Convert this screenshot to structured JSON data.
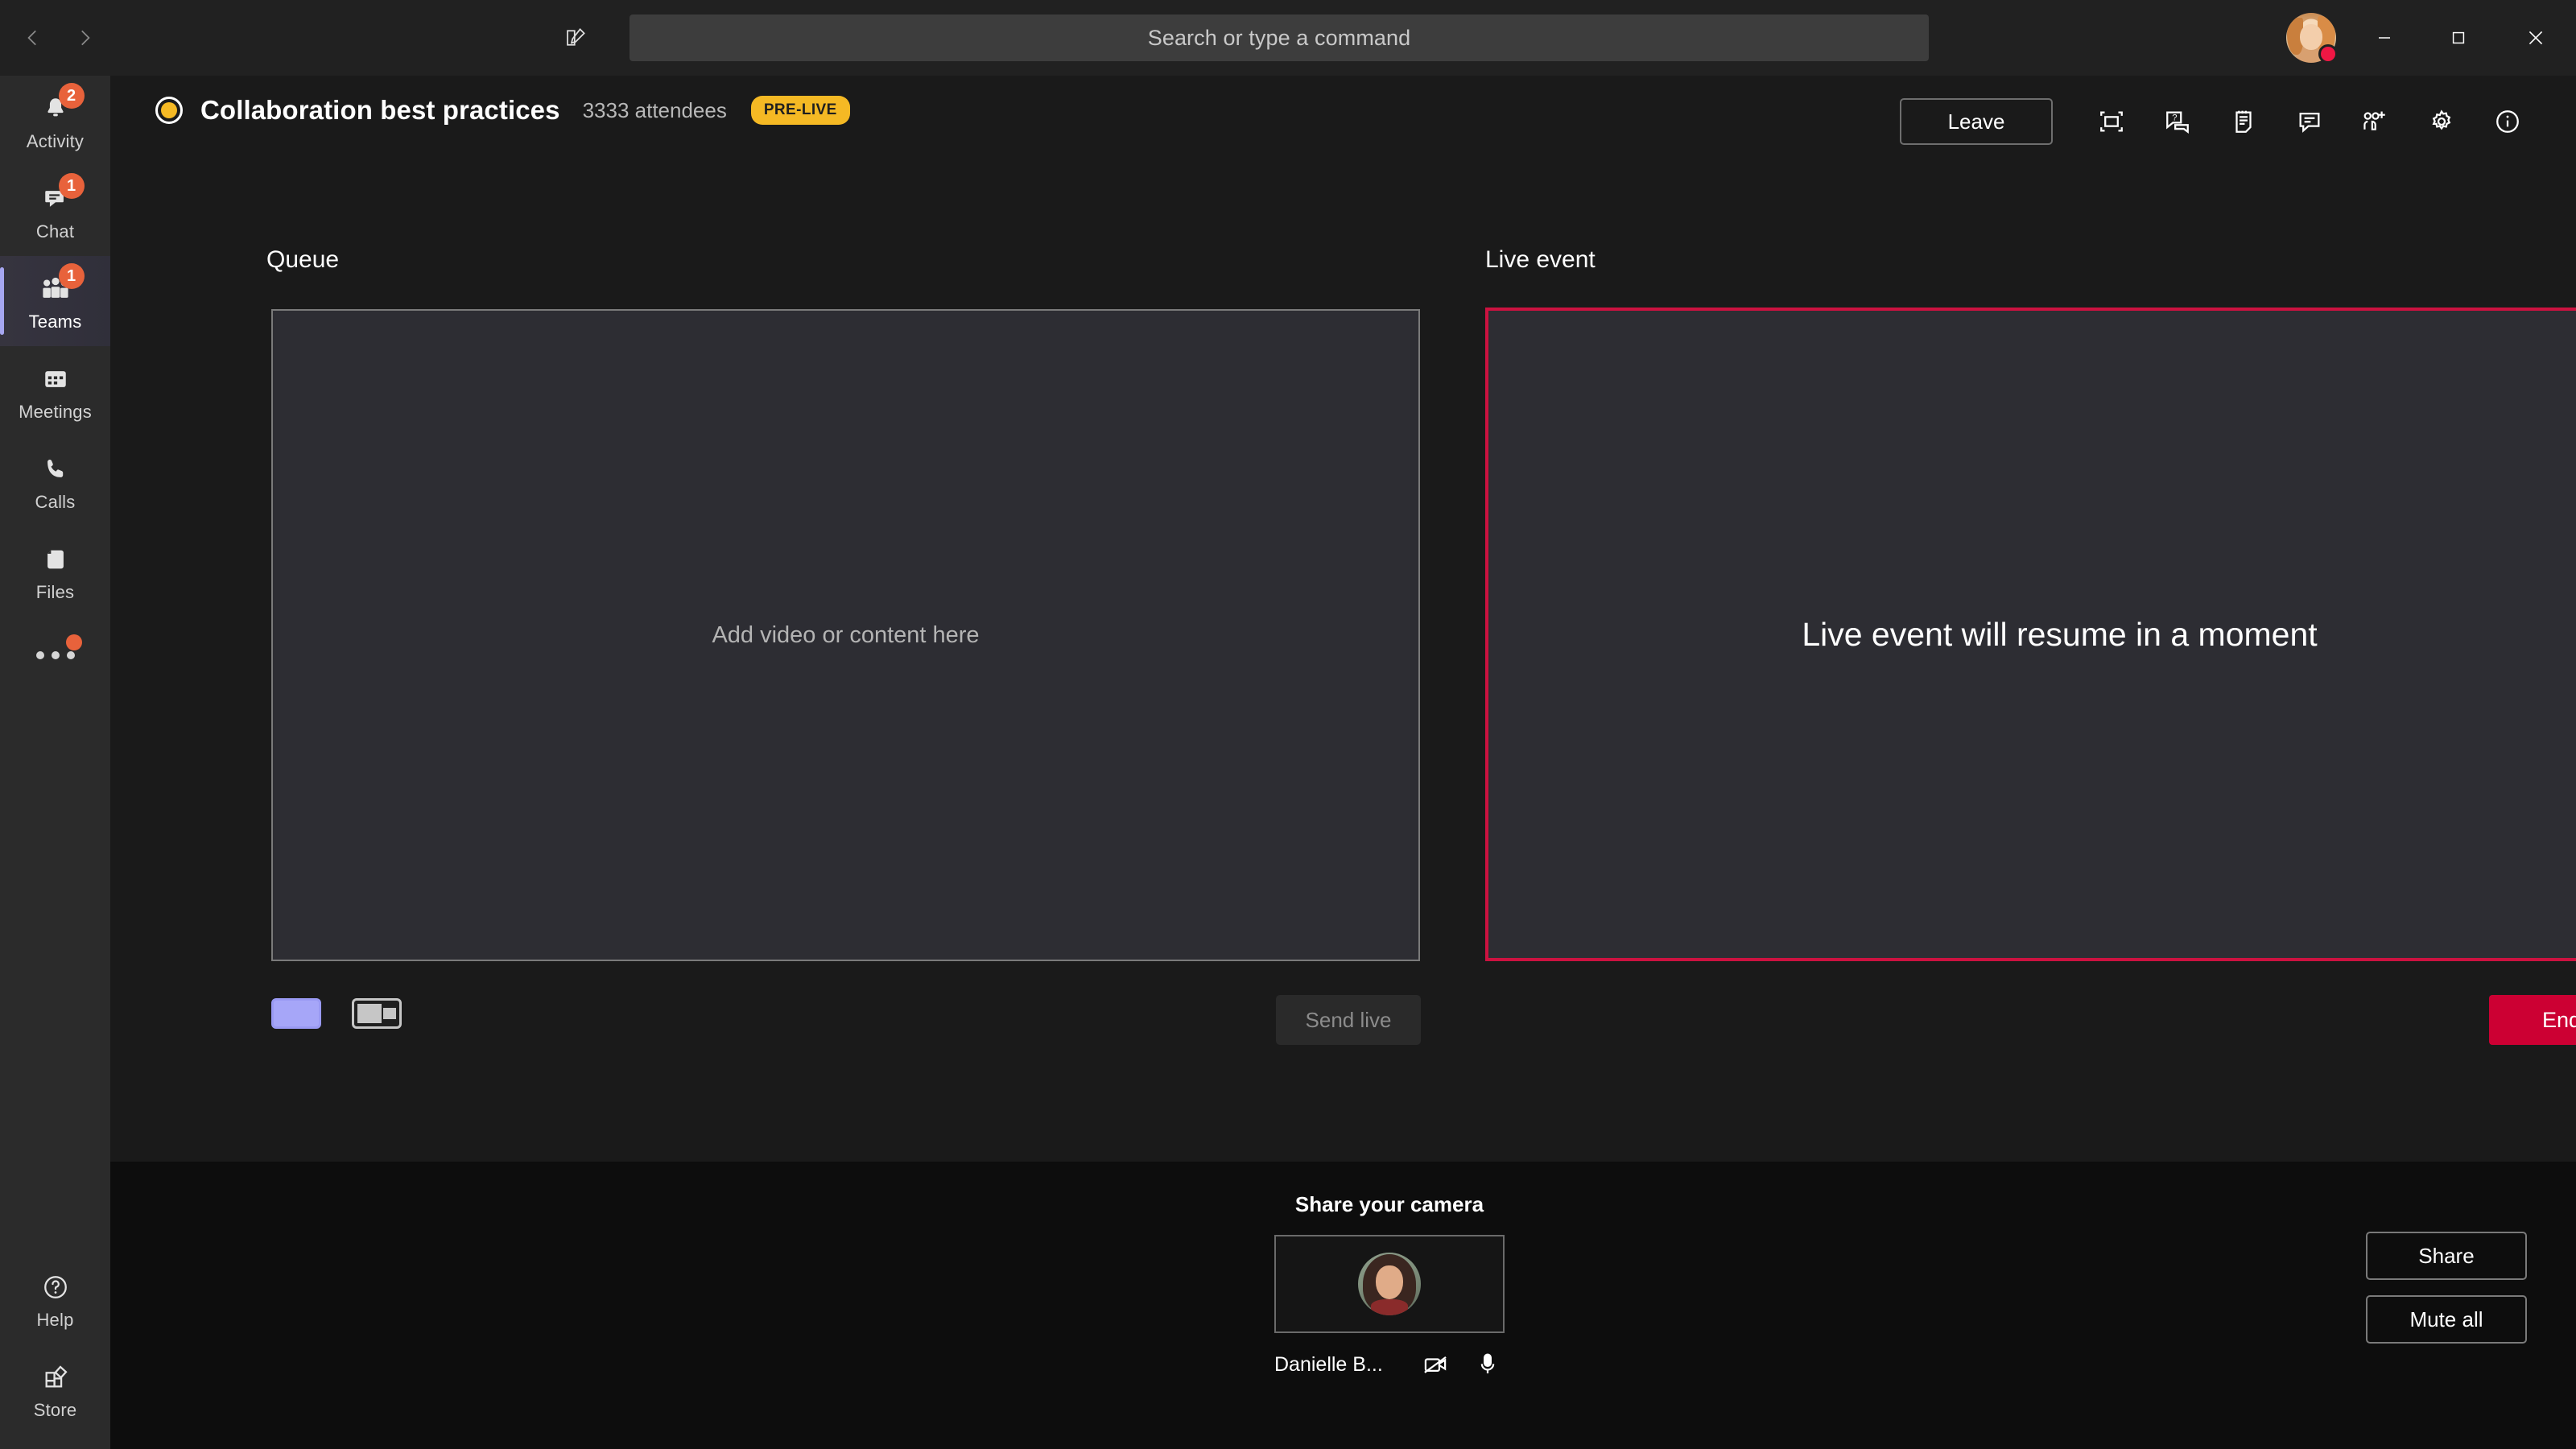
{
  "titlebar": {
    "back_icon": "chevron-left-icon",
    "forward_icon": "chevron-right-icon",
    "compose_icon": "compose-icon",
    "search": {
      "placeholder": "Search or type a command",
      "value": ""
    },
    "avatar_name": "user-avatar",
    "presence": "busy",
    "minimize_label": "Minimize",
    "maximize_label": "Maximize",
    "close_label": "Close"
  },
  "rail": {
    "items": [
      {
        "label": "Activity",
        "icon": "bell-icon",
        "badge": "2",
        "active": false
      },
      {
        "label": "Chat",
        "icon": "chat-icon",
        "badge": "1",
        "active": false
      },
      {
        "label": "Teams",
        "icon": "teams-icon",
        "badge": "1",
        "active": true
      },
      {
        "label": "Meetings",
        "icon": "calendar-icon",
        "badge": "",
        "active": false
      },
      {
        "label": "Calls",
        "icon": "phone-icon",
        "badge": "",
        "active": false
      },
      {
        "label": "Files",
        "icon": "files-icon",
        "badge": "",
        "active": false
      }
    ],
    "more_label": "More apps",
    "bottom_items": [
      {
        "label": "Help",
        "icon": "help-icon"
      },
      {
        "label": "Store",
        "icon": "store-icon"
      }
    ]
  },
  "event": {
    "status_icon": "live-status-dot",
    "title": "Collaboration best practices",
    "attendees": "3333 attendees",
    "state_badge": "PRE-LIVE",
    "leave_label": "Leave",
    "toolbar": [
      {
        "name": "fit-to-frame-icon",
        "label": "Full screen"
      },
      {
        "name": "qna-icon",
        "label": "Q&A"
      },
      {
        "name": "notes-icon",
        "label": "Meeting notes"
      },
      {
        "name": "chat-icon",
        "label": "Show conversation"
      },
      {
        "name": "add-people-icon",
        "label": "Add participants"
      },
      {
        "name": "settings-gear-icon",
        "label": "Device settings"
      },
      {
        "name": "info-icon",
        "label": "Event info"
      }
    ]
  },
  "queue": {
    "label": "Queue",
    "placeholder": "Add video or content here",
    "layouts": [
      {
        "name": "layout-single",
        "selected": true
      },
      {
        "name": "layout-content-with-video",
        "selected": false
      }
    ],
    "send_live_label": "Send live",
    "send_live_enabled": false
  },
  "live": {
    "label": "Live event",
    "message": "Live event will resume in a moment",
    "end_label": "End",
    "border_color": "#cc1240"
  },
  "bottom": {
    "camera_title": "Share your camera",
    "participant_name": "Danielle B...",
    "camera_icon": "camera-off-icon",
    "mic_icon": "microphone-icon",
    "share_label": "Share",
    "mute_all_label": "Mute all"
  },
  "colors": {
    "accent_purple": "#a6a6f8",
    "live_red": "#cc1240",
    "end_red": "#cc0033",
    "prelive_amber": "#f5b924",
    "badge_orange": "#e8623b",
    "stage_bg": "#2d2d33",
    "app_bg": "#1a1a1a",
    "bottom_bg": "#0d0d0d",
    "rail_bg": "#2b2b2b"
  }
}
